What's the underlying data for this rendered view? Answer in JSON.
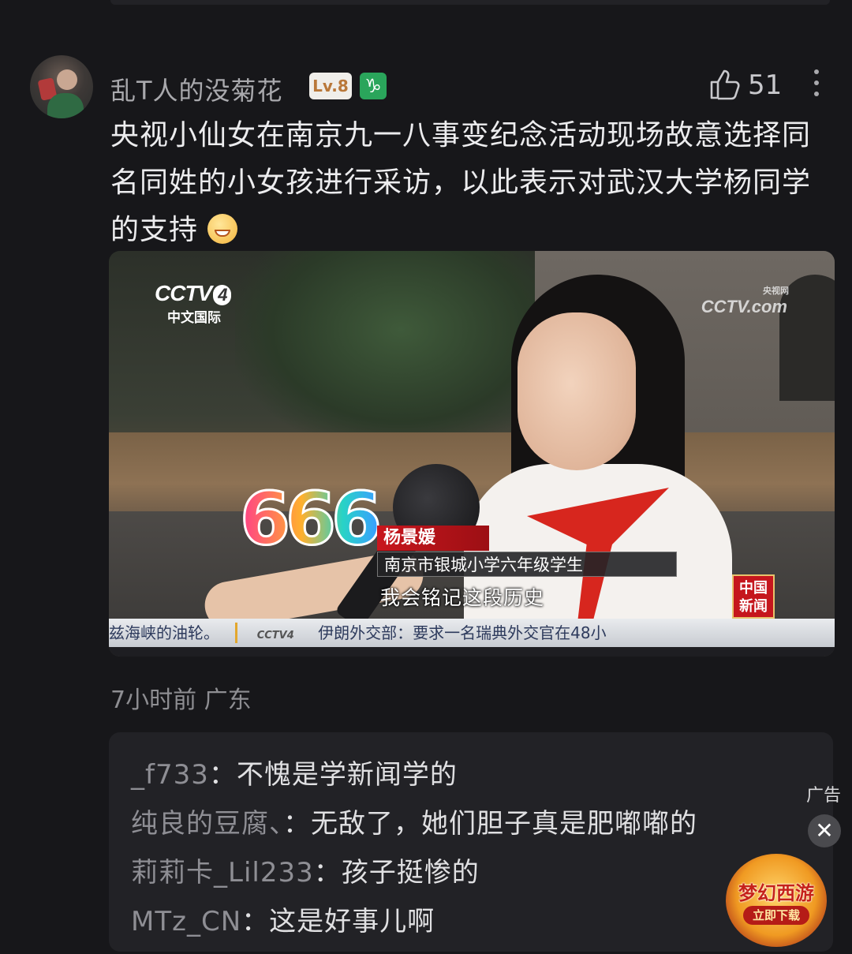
{
  "comment": {
    "username": "乱T人的没菊花",
    "level_badge": "Lv.8",
    "zodiac_badge": "♑",
    "like_count": "51",
    "text": "央视小仙女在南京九一八事变纪念活动现场故意选择同名同姓的小女孩进行采访，以此表示对武汉大学杨同学的支持",
    "emoji": "grinning-face-emoji",
    "time": "7小时前",
    "location": "广东"
  },
  "video": {
    "channel_logo": "CCTV",
    "channel_number": "4",
    "channel_sub": "中文国际",
    "watermark_small": "央视网",
    "watermark": "CCTV.com",
    "sticker": "666",
    "name_tag": "杨景媛",
    "title_tag": "南京市银城小学六年级学生",
    "subtitle": "我会铭记这段历史",
    "news_logo": "中国新闻",
    "ticker_left": "兹海峡的油轮。",
    "ticker_logo": "CCTV4",
    "ticker_right": "伊朗外交部：要求一名瑞典外交官在48小"
  },
  "replies": [
    {
      "who": "_f733",
      "sep": "：",
      "text": "不愧是学新闻学的"
    },
    {
      "who": "纯良的豆腐、",
      "sep": "：",
      "text": "无敌了，她们胆子真是肥嘟嘟的"
    },
    {
      "who": "莉莉卡_Lil233",
      "sep": "：",
      "text": "孩子挺惨的"
    },
    {
      "who": "MTz_CN",
      "sep": "：",
      "text": "这是好事儿啊"
    }
  ],
  "ad": {
    "label": "广告",
    "close": "✕",
    "game_title": "梦幻西游",
    "game_button": "立即下载"
  },
  "colors": {
    "background": "#17171a",
    "reply_box": "#222226",
    "badge_green": "#2aa55b",
    "news_red": "#c8161d"
  }
}
